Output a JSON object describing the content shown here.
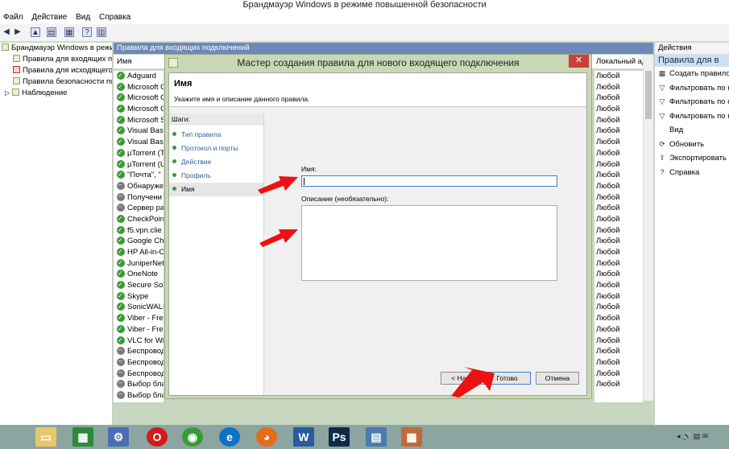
{
  "window": {
    "title": "Брандмауэр Windows в режиме повышенной безопасности"
  },
  "menu": [
    "Файл",
    "Действие",
    "Вид",
    "Справка"
  ],
  "tree": {
    "root": "Брандмауэр Windows в режим",
    "items": [
      "Правила для входящих подк",
      "Правила для исходящего п",
      "Правила безопасности под",
      "Наблюдение"
    ]
  },
  "pane": {
    "header": "Правила для входящих подключений",
    "col_name": "Имя",
    "col_profile": "Локальный ад"
  },
  "rules": [
    {
      "name": "Adguard",
      "on": true
    },
    {
      "name": "Microsoft C",
      "on": true
    },
    {
      "name": "Microsoft C",
      "on": true
    },
    {
      "name": "Microsoft C",
      "on": true
    },
    {
      "name": "Microsoft S",
      "on": true
    },
    {
      "name": "Visual Basic",
      "on": true
    },
    {
      "name": "Visual Basic",
      "on": true
    },
    {
      "name": "µTorrent (T",
      "on": true
    },
    {
      "name": "µTorrent (U",
      "on": true
    },
    {
      "name": "\"Почта\", \"",
      "on": true
    },
    {
      "name": "Обнаруже",
      "on": false
    },
    {
      "name": "Получени",
      "on": false
    },
    {
      "name": "Сервер ра",
      "on": false
    },
    {
      "name": "CheckPoin",
      "on": true
    },
    {
      "name": "f5.vpn.clie",
      "on": true
    },
    {
      "name": "Google Cha",
      "on": true
    },
    {
      "name": "HP All-in-C",
      "on": true
    },
    {
      "name": "JuniperNet",
      "on": true
    },
    {
      "name": "OneNote",
      "on": true
    },
    {
      "name": "Secure Soc",
      "on": true
    },
    {
      "name": "Skype",
      "on": true
    },
    {
      "name": "SonicWALL",
      "on": true
    },
    {
      "name": "Viber - Free",
      "on": true
    },
    {
      "name": "Viber - Free",
      "on": true
    },
    {
      "name": "VLC for Wi",
      "on": true
    },
    {
      "name": "Беспровод",
      "on": false
    },
    {
      "name": "Беспровод",
      "on": false
    },
    {
      "name": "Беспровод",
      "on": false
    },
    {
      "name": "Выбор бла",
      "on": false
    },
    {
      "name": "Выбор бла",
      "on": false
    }
  ],
  "profiles": [
    "Любой",
    "Любой",
    "Любой",
    "Любой",
    "Любой",
    "Любой",
    "Любой",
    "Любой",
    "Любой",
    "Любой",
    "Любой",
    "Любой",
    "Любой",
    "Любой",
    "Любой",
    "Любой",
    "Любой",
    "Любой",
    "Любой",
    "Любой",
    "Любой",
    "Любой",
    "Любой",
    "Любой",
    "Любой",
    "Любой",
    "Любой",
    "Любой",
    "Любой"
  ],
  "actions": {
    "title": "Действия",
    "subtitle": "Правила для в",
    "items": [
      {
        "label": "Создать правило",
        "icon": "new-rule-icon",
        "glyph": "▦"
      },
      {
        "label": "Фильтровать по п",
        "icon": "filter-icon",
        "glyph": "▽"
      },
      {
        "label": "Фильтровать по с",
        "icon": "filter-icon",
        "glyph": "▽"
      },
      {
        "label": "Фильтровать по г",
        "icon": "filter-icon",
        "glyph": "▽"
      },
      {
        "label": "Вид",
        "icon": "view-icon",
        "glyph": ""
      },
      {
        "label": "Обновить",
        "icon": "refresh-icon",
        "glyph": "⟳"
      },
      {
        "label": "Экспортировать с",
        "icon": "export-icon",
        "glyph": "⇪"
      },
      {
        "label": "Справка",
        "icon": "help-icon",
        "glyph": "?"
      }
    ]
  },
  "dialog": {
    "title": "Мастер создания правила для нового входящего подключения",
    "close": "✕",
    "heading": "Имя",
    "subheading": "Укажите имя и описание данного правила.",
    "steps_title": "Шаги:",
    "steps": [
      "Тип правила",
      "Протокол и порты",
      "Действие",
      "Профиль",
      "Имя"
    ],
    "name_label": "Имя:",
    "name_value": "",
    "desc_label": "Описание (необязательно):",
    "desc_value": "",
    "back": "< Назад",
    "finish": "Готово",
    "cancel": "Отмена"
  },
  "taskbar": {
    "tray": "◂ 🔊 ▤ ✉"
  },
  "colors": {
    "arrow": "#ee1111",
    "header": "#6e89b9",
    "dialog_frame": "#c8d7b4"
  }
}
